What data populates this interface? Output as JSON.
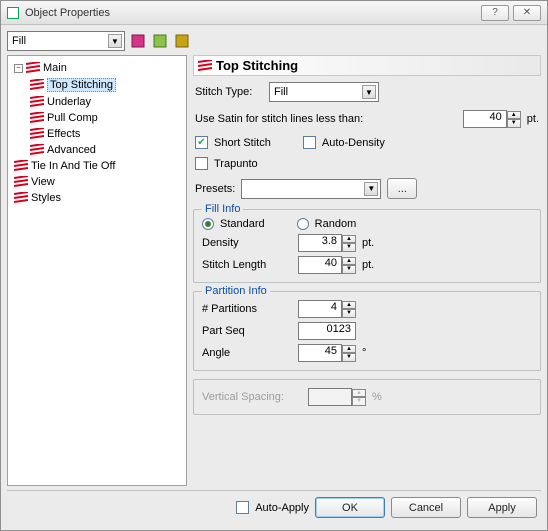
{
  "window": {
    "title": "Object Properties"
  },
  "toolbar": {
    "category_combo": "Fill"
  },
  "tree": {
    "root": "Main",
    "items": [
      "Top Stitching",
      "Underlay",
      "Pull Comp",
      "Effects",
      "Advanced"
    ],
    "tie": "Tie In And Tie Off",
    "view": "View",
    "styles": "Styles"
  },
  "panel": {
    "title": "Top Stitching",
    "stitch_type_label": "Stitch Type:",
    "stitch_type_value": "Fill",
    "use_satin_label": "Use Satin for stitch lines less than:",
    "use_satin_value": "40",
    "use_satin_unit": "pt.",
    "short_stitch": "Short Stitch",
    "auto_density": "Auto-Density",
    "trapunto": "Trapunto",
    "presets_label": "Presets:",
    "presets_btn": "...",
    "fill_info": {
      "legend": "Fill Info",
      "standard": "Standard",
      "random": "Random",
      "density_label": "Density",
      "density_value": "3.8",
      "density_unit": "pt.",
      "stitch_len_label": "Stitch Length",
      "stitch_len_value": "40",
      "stitch_len_unit": "pt."
    },
    "partition": {
      "legend": "Partition Info",
      "num_label": "# Partitions",
      "num_value": "4",
      "seq_label": "Part Seq",
      "seq_value": "0123",
      "angle_label": "Angle",
      "angle_value": "45",
      "angle_unit": "°"
    },
    "vspacing_label": "Vertical Spacing:",
    "vspacing_unit": "%"
  },
  "footer": {
    "auto_apply": "Auto-Apply",
    "ok": "OK",
    "cancel": "Cancel",
    "apply": "Apply"
  }
}
